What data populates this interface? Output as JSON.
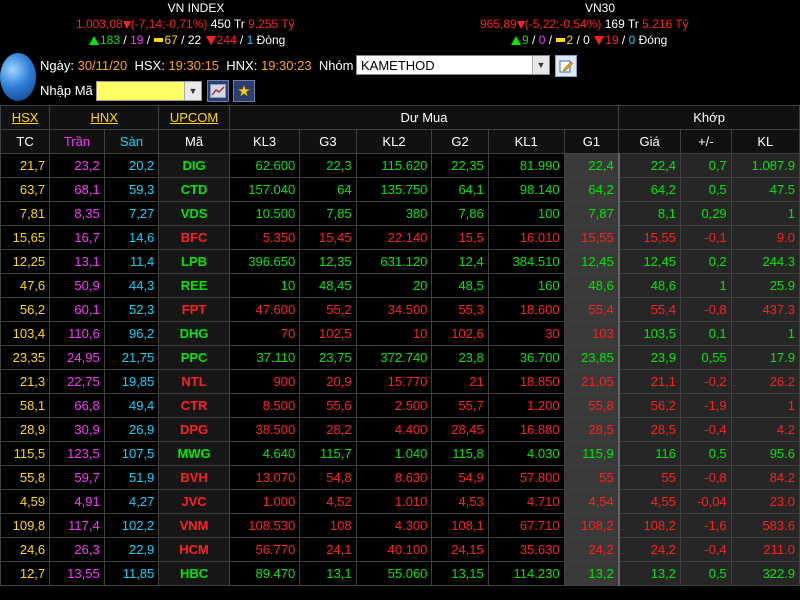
{
  "vnindex": {
    "name": "VN INDEX",
    "value": "1.003,08",
    "change": "(-7,14;-0,71%)",
    "volume": "450",
    "volume_unit": "Tr",
    "value_money": "9.255 Tỷ",
    "up": "183",
    "ceil": "19",
    "ref": "67",
    "down_count": "22",
    "floor_down": "244",
    "floor": "1",
    "status": "Đóng"
  },
  "vn30": {
    "name": "VN30",
    "value": "965,89",
    "change": "(-5,22;-0,54%)",
    "volume": "169",
    "volume_unit": "Tr",
    "value_money": "5.216 Tỷ",
    "up": "9",
    "ceil": "0",
    "ref": "2",
    "down_count": "0",
    "floor_down": "19",
    "floor": "0",
    "status": "Đóng"
  },
  "toolbar": {
    "date_label": "Ngày:",
    "date": "30/11/20",
    "hsx_label": "HSX:",
    "hsx_time": "19:30:15",
    "hnx_label": "HNX:",
    "hnx_time": "19:30:23",
    "group_label": "Nhóm",
    "group_value": "KAMETHOD",
    "code_label": "Nhập Mã",
    "edit_icon": "edit-icon",
    "chart_icon": "chart-icon",
    "star_icon": "star-icon"
  },
  "table": {
    "exchange_tabs": [
      "HSX",
      "HNX",
      "UPCOM"
    ],
    "group_buy": "Dư Mua",
    "group_match": "Khớp",
    "headers": [
      "TC",
      "Trần",
      "Sàn",
      "Mã",
      "KL3",
      "G3",
      "KL2",
      "G2",
      "KL1",
      "G1",
      "Giá",
      "+/-",
      "KL"
    ],
    "rows": [
      [
        "21,7",
        "23,2",
        "20,2",
        "DIG",
        "62.600",
        "22,3",
        "115.620",
        "22,35",
        "81.990",
        "22,4",
        "22,4",
        "0,7",
        "1.087.9"
      ],
      [
        "63,7",
        "68,1",
        "59,3",
        "CTD",
        "157.040",
        "64",
        "135.750",
        "64,1",
        "98.140",
        "64,2",
        "64,2",
        "0,5",
        "47.5"
      ],
      [
        "7,81",
        "8,35",
        "7,27",
        "VDS",
        "10.500",
        "7,85",
        "380",
        "7,86",
        "100",
        "7,87",
        "8,1",
        "0,29",
        "1"
      ],
      [
        "15,65",
        "16,7",
        "14,6",
        "BFC",
        "5.350",
        "15,45",
        "22.140",
        "15,5",
        "16.010",
        "15,55",
        "15,55",
        "-0,1",
        "9.0"
      ],
      [
        "12,25",
        "13,1",
        "11,4",
        "LPB",
        "396.650",
        "12,35",
        "631.120",
        "12,4",
        "384.510",
        "12,45",
        "12,45",
        "0,2",
        "244.3"
      ],
      [
        "47,6",
        "50,9",
        "44,3",
        "REE",
        "10",
        "48,45",
        "20",
        "48,5",
        "160",
        "48,6",
        "48,6",
        "1",
        "25.9"
      ],
      [
        "56,2",
        "60,1",
        "52,3",
        "FPT",
        "47.600",
        "55,2",
        "34.500",
        "55,3",
        "18.600",
        "55,4",
        "55,4",
        "-0,8",
        "437.3"
      ],
      [
        "103,4",
        "110,6",
        "96,2",
        "DHG",
        "70",
        "102,5",
        "10",
        "102,6",
        "30",
        "103",
        "103,5",
        "0,1",
        "1"
      ],
      [
        "23,35",
        "24,95",
        "21,75",
        "PPC",
        "37.110",
        "23,75",
        "372.740",
        "23,8",
        "36.700",
        "23,85",
        "23,9",
        "0,55",
        "17.9"
      ],
      [
        "21,3",
        "22,75",
        "19,85",
        "NTL",
        "900",
        "20,9",
        "15.770",
        "21",
        "18.850",
        "21,05",
        "21,1",
        "-0,2",
        "26.2"
      ],
      [
        "58,1",
        "66,8",
        "49,4",
        "CTR",
        "8.500",
        "55,6",
        "2.500",
        "55,7",
        "1.200",
        "55,8",
        "56,2",
        "-1,9",
        "1"
      ],
      [
        "28,9",
        "30,9",
        "26,9",
        "DPG",
        "38.500",
        "28,2",
        "4.400",
        "28,45",
        "16.880",
        "28,5",
        "28,5",
        "-0,4",
        "4.2"
      ],
      [
        "115,5",
        "123,5",
        "107,5",
        "MWG",
        "4.640",
        "115,7",
        "1.040",
        "115,8",
        "4.030",
        "115,9",
        "116",
        "0,5",
        "95.6"
      ],
      [
        "55,8",
        "59,7",
        "51,9",
        "BVH",
        "13.070",
        "54,8",
        "8.630",
        "54,9",
        "57.800",
        "55",
        "55",
        "-0,8",
        "84.2"
      ],
      [
        "4,59",
        "4,91",
        "4,27",
        "JVC",
        "1.000",
        "4,52",
        "1.010",
        "4,53",
        "4.710",
        "4,54",
        "4,55",
        "-0,04",
        "23.0"
      ],
      [
        "109,8",
        "117,4",
        "102,2",
        "VNM",
        "108.530",
        "108",
        "4.300",
        "108,1",
        "67.710",
        "108,2",
        "108,2",
        "-1,6",
        "583.6"
      ],
      [
        "24,6",
        "26,3",
        "22,9",
        "HCM",
        "56.770",
        "24,1",
        "40.100",
        "24,15",
        "35.630",
        "24,2",
        "24,2",
        "-0,4",
        "211.0"
      ],
      [
        "12,7",
        "13,55",
        "11,85",
        "HBC",
        "89.470",
        "13,1",
        "55.060",
        "13,15",
        "114.230",
        "13,2",
        "13,2",
        "0,5",
        "322.9"
      ]
    ],
    "colors": {
      "up": "#00e600",
      "down": "#ff2020",
      "ref": "#ffd800",
      "ceil": "#ff33ff",
      "floor": "#00d8ff"
    }
  }
}
